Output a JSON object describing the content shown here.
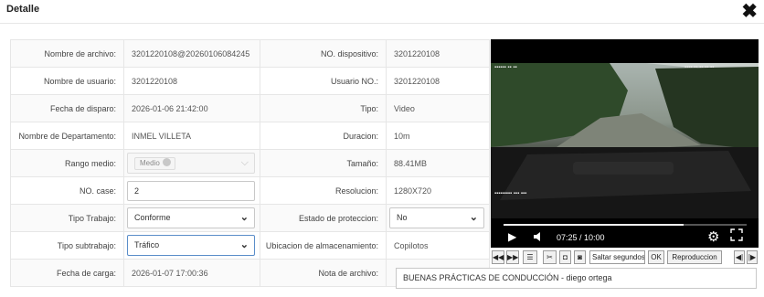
{
  "dialog": {
    "title": "Detalle",
    "close_icon": "close-icon"
  },
  "form": {
    "rows": [
      {
        "label_left": "Nombre de archivo:",
        "value_left": "3201220108@20260106084245",
        "label_right": "NO. dispositivo:",
        "value_right": "3201220108"
      },
      {
        "label_left": "Nombre de usuario:",
        "value_left": "3201220108",
        "label_right": "Usuario NO.:",
        "value_right": "3201220108"
      },
      {
        "label_left": "Fecha de disparo:",
        "value_left": "2026-01-06 21:42:00",
        "label_right": "Tipo:",
        "value_right": "Video"
      },
      {
        "label_left": "Nombre de Departamento:",
        "value_left": "INMEL VILLETA",
        "label_right": "Duracion:",
        "value_right": "10m"
      },
      {
        "label_left": "Rango medio:",
        "value_left": "Medio",
        "label_right": "Tamaño:",
        "value_right": "88.41MB"
      },
      {
        "label_left": "NO. case:",
        "value_left": "2",
        "label_right": "Resolucion:",
        "value_right": "1280X720"
      },
      {
        "label_left": "Tipo Trabajo:",
        "value_left": "Conforme",
        "label_right": "Estado de proteccion:",
        "value_right": "No"
      },
      {
        "label_left": "Tipo subtrabajo:",
        "value_left": "Tráfico",
        "label_right": "Ubicacion de almacenamiento:",
        "value_right": "Copilotos"
      },
      {
        "label_left": "Fecha de carga:",
        "value_left": "2026-01-07 17:00:36",
        "label_right": "Nota de archivo:",
        "value_right": "BUENAS PRÁCTICAS DE CONDUCCIÓN - diego ortega"
      }
    ]
  },
  "video": {
    "time": "07:25 / 10:00",
    "progress": 0.74,
    "icons": {
      "play": "play-icon",
      "volume": "volume-icon",
      "settings": "gear-icon",
      "fullscreen": "fullscreen-icon"
    }
  },
  "toolbar": {
    "first_icon": "rewind-icon",
    "fast_icon": "fast-forward-icon",
    "list_icon": "list-icon",
    "cut_icon": "scissors-icon",
    "skip_placeholder": "Saltar segundos",
    "ok_label": "OK",
    "play_mode_label": "Reproduccion",
    "prev_icon": "skip-prev-icon",
    "next_icon": "skip-next-icon"
  }
}
